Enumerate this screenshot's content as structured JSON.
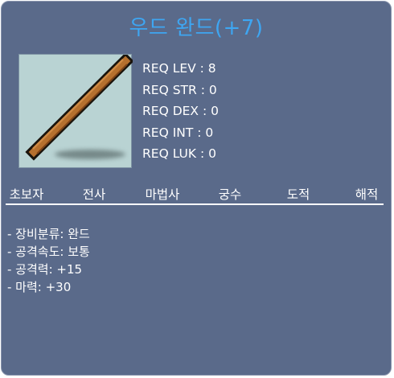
{
  "item": {
    "name": "우드 완드(+7)",
    "icon": "wooden-wand-icon",
    "colors": {
      "panel": "#5a6a8a",
      "title": "#3ea6f2",
      "icon_bg": "#b9d3d3"
    }
  },
  "requirements": [
    "REQ LEV : 8",
    "REQ STR : 0",
    "REQ DEX : 0",
    "REQ INT : 0",
    "REQ LUK : 0"
  ],
  "jobs": [
    "초보자",
    "전사",
    "마법사",
    "궁수",
    "도적",
    "해적"
  ],
  "stats": [
    "- 장비분류: 완드",
    "- 공격속도: 보통",
    "- 공격력: +15",
    "- 마력: +30"
  ]
}
